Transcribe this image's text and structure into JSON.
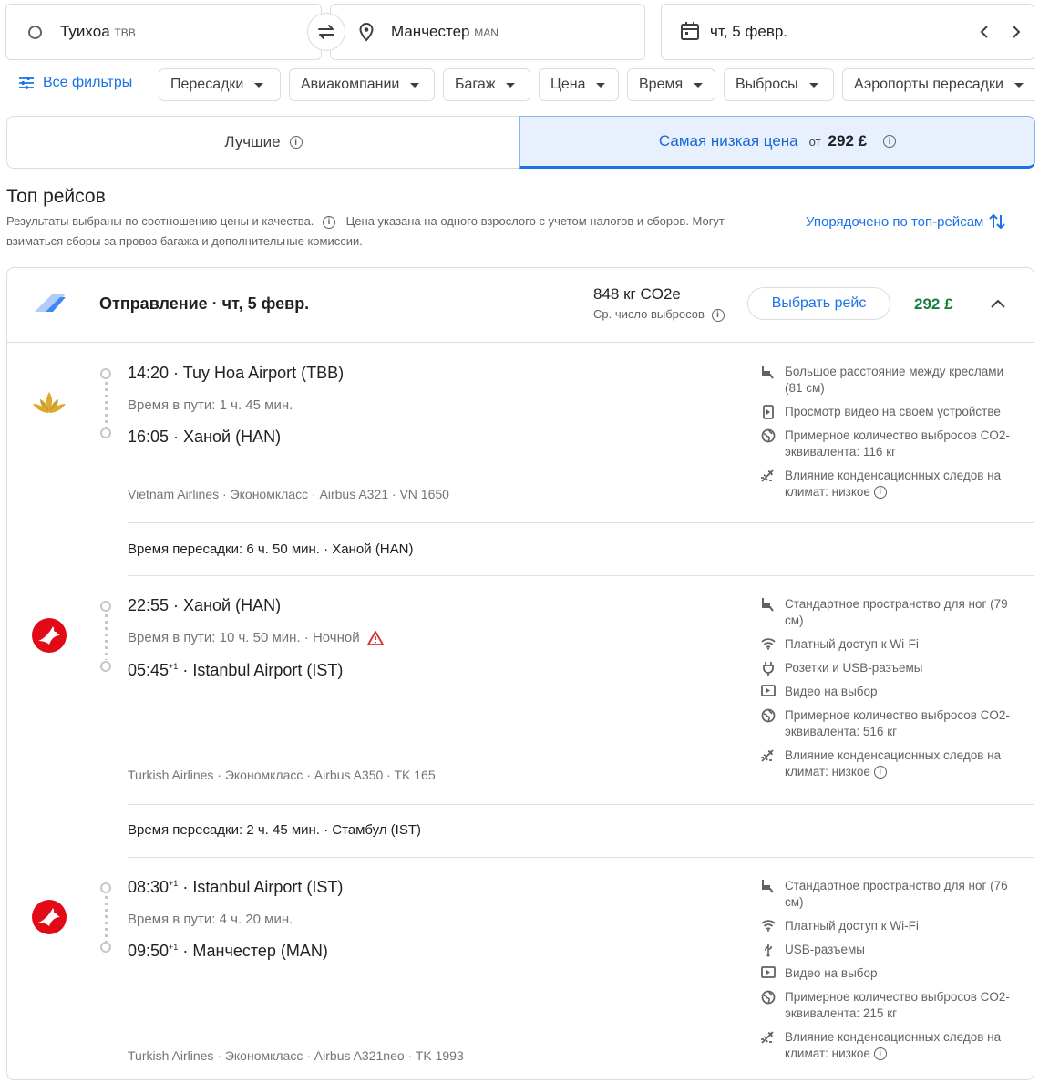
{
  "search": {
    "origin": "Туихоа",
    "origin_code": "TBB",
    "destination": "Манчестер",
    "destination_code": "MAN",
    "date": "чт, 5 февр."
  },
  "filters": {
    "all": "Все фильтры",
    "chips": [
      "Пересадки",
      "Авиакомпании",
      "Багаж",
      "Цена",
      "Время",
      "Выбросы",
      "Аэропорты пересадки"
    ]
  },
  "tabs": {
    "best": "Лучшие",
    "cheapest": "Самая низкая цена",
    "cheapest_from": "от",
    "cheapest_price": "292 £"
  },
  "results": {
    "title": "Топ рейсов",
    "note1": "Результаты выбраны по соотношению цены и качества.",
    "note2": "Цена указана на одного взрослого с учетом налогов и сборов. Могут",
    "note3": "взиматься сборы за провоз багажа и дополнительные комиссии.",
    "sort": "Упорядочено по топ-рейсам"
  },
  "card": {
    "header": "Отправление · чт, 5 февр.",
    "co2": "848 кг CO2e",
    "co2_sub": "Ср. число выбросов",
    "select": "Выбрать рейс",
    "price": "292 £"
  },
  "segments": [
    {
      "dep_time": "14:20",
      "dep_sup": "",
      "dep_airport": "Tuy Hoa Airport (TBB)",
      "duration": "Время в пути: 1 ч. 45 мин.",
      "overnight": "",
      "arr_time": "16:05",
      "arr_sup": "",
      "arr_airport": "Ханой (HAN)",
      "meta": "Vietnam Airlines · Эконом­класс · Airbus A321 · VN 1650",
      "amenities": [
        {
          "icon": "seat-icon",
          "text": "Большое расстояние между креслами (81 см)"
        },
        {
          "icon": "phone-video-icon",
          "text": "Просмотр видео на своем устройстве"
        },
        {
          "icon": "globe-icon",
          "text": "Примерное количество выбросов CO2-эквивалента: 116 кг"
        },
        {
          "icon": "contrail-icon",
          "text": "Влияние конденсационных следов на климат: низкое"
        }
      ]
    },
    {
      "dep_time": "22:55",
      "dep_sup": "",
      "dep_airport": "Ханой (HAN)",
      "duration": "Время в пути: 10 ч. 50 мин. · Ночной",
      "overnight": "warning",
      "arr_time": "05:45",
      "arr_sup": "+1",
      "arr_airport": "Istanbul Airport (IST)",
      "meta": "Turkish Airlines · Экономкласс · Airbus A350 · TK 165",
      "amenities": [
        {
          "icon": "seat-icon",
          "text": "Стандартное пространство для ног (79 см)"
        },
        {
          "icon": "wifi-icon",
          "text": "Платный доступ к Wi-Fi"
        },
        {
          "icon": "plug-icon",
          "text": "Розетки и USB-разъемы"
        },
        {
          "icon": "video-icon",
          "text": "Видео на выбор"
        },
        {
          "icon": "globe-icon",
          "text": "Примерное количество выбросов CO2-эквивалента: 516 кг"
        },
        {
          "icon": "contrail-icon",
          "text": "Влияние конденсационных следов на климат: низкое"
        }
      ]
    },
    {
      "dep_time": "08:30",
      "dep_sup": "+1",
      "dep_airport": "Istanbul Airport (IST)",
      "duration": "Время в пути: 4 ч. 20 мин.",
      "overnight": "",
      "arr_time": "09:50",
      "arr_sup": "+1",
      "arr_airport": "Манчестер (MAN)",
      "meta": "Turkish Airlines · Экономкласс · Airbus A321neo · TK 1993",
      "amenities": [
        {
          "icon": "seat-icon",
          "text": "Стандартное пространство для ног (76 см)"
        },
        {
          "icon": "wifi-icon",
          "text": "Платный доступ к Wi-Fi"
        },
        {
          "icon": "usb-icon",
          "text": "USB-разъемы"
        },
        {
          "icon": "video-icon",
          "text": "Видео на выбор"
        },
        {
          "icon": "globe-icon",
          "text": "Примерное количество выбросов CO2-эквивалента: 215 кг"
        },
        {
          "icon": "contrail-icon",
          "text": "Влияние конденсационных следов на климат: низкое"
        }
      ]
    }
  ],
  "layovers": [
    "Время пересадки: 6 ч. 50 мин. · Ханой (HAN)",
    "Время пересадки: 2 ч. 45 мин. · Стамбул (IST)"
  ],
  "colors": {
    "accent": "#1a73e8",
    "price_green": "#188038",
    "turkish_red": "#e30a17",
    "vn_gold": "#c9a227",
    "warning": "#d93025"
  }
}
